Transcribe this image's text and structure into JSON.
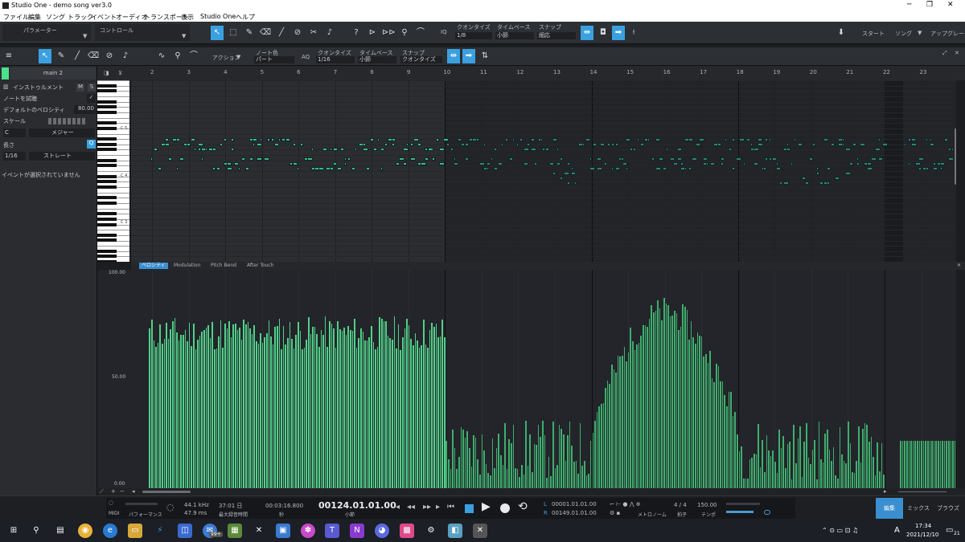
{
  "window": {
    "title": "Studio One - demo song ver3.0",
    "controls": [
      "─",
      "❐",
      "✕"
    ]
  },
  "menu": [
    "ファイル",
    "編集",
    "ソング",
    "トラック",
    "イベント",
    "オーディオ",
    "トランスポート",
    "表示",
    "Studio One",
    "ヘルプ"
  ],
  "toolbar": {
    "parameter_label": "パラメーター",
    "control_label": "コントロール",
    "iq": "IQ",
    "quantize_label": "クオンタイズ",
    "quantize_value": "1/8",
    "timebase_label": "タイムベース",
    "timebase_value": "小節",
    "snap_label": "スナップ",
    "snap_value": "細応",
    "start": "スタート",
    "song": "ソング",
    "upgrade": "アップグレード"
  },
  "editor": {
    "action": "アクション",
    "note_color_label": "ノート色",
    "note_color_value": "パート",
    "aq": "AQ",
    "quantize_label": "クオンタイズ",
    "quantize_value": "1/16",
    "timebase_label": "タイムベース",
    "timebase_value": "小節",
    "snap_label": "スナップ",
    "snap_value": "クオンタイズ"
  },
  "inspector": {
    "track": "main 2",
    "instrument": "インストゥルメント",
    "m": "M",
    "s": "S",
    "note_preview": "ノートを試聴",
    "default_velocity": "デフォルトのベロシティ",
    "default_velocity_value": "80.00",
    "scale": "スケール",
    "key": "C",
    "scale_type": "メジャー",
    "length": "長さ",
    "length_value": "1/16",
    "length_mode": "ストレート",
    "no_event": "イベントが選択されていません"
  },
  "keys": [
    "C 5",
    "C 4",
    "C 3"
  ],
  "ruler": [
    "2",
    "3",
    "4",
    "5",
    "6",
    "7",
    "8",
    "9",
    "10",
    "11",
    "12",
    "13",
    "14",
    "15",
    "16",
    "17",
    "18",
    "19",
    "20",
    "21",
    "22",
    "23"
  ],
  "lanes": [
    "ベロシティ",
    "Modulation",
    "Pitch Bend",
    "After Touch"
  ],
  "vel_axis": [
    "100.00",
    "50.00",
    "0.00"
  ],
  "transport": {
    "midi": "MIDI",
    "performance": "パフォーマンス",
    "sample_rate": "44.1 kHz",
    "latency": "47.9 ms",
    "rec_time": "37:01 日",
    "rec_time_label": "最大録音時間",
    "seconds": "00:03:16.800",
    "seconds_label": "秒",
    "bars": "00124.01.01.00",
    "bars_label": "小節",
    "loop_l_tag": "L",
    "loop_r_tag": "R",
    "loop_l": "00001.01.01.00",
    "loop_r": "00149.01.01.00",
    "metronome": "メトロノーム",
    "signature": "4 / 4",
    "signature_label": "拍子",
    "tempo": "150.00",
    "tempo_label": "テンポ"
  },
  "screens": [
    "編集",
    "ミックス",
    "ブラウズ"
  ],
  "taskbar": {
    "time": "17:34",
    "date": "2021/12/10",
    "badge": "99+",
    "notif": "21",
    "ime": "A"
  },
  "chart_data": {
    "type": "bar",
    "ylim": [
      0,
      100
    ],
    "velocity_profile": [
      {
        "from_bar": 1.9,
        "to_bar": 10,
        "level": 72,
        "spread": 8
      },
      {
        "from_bar": 10,
        "to_bar": 14,
        "level": 18,
        "spread": 14
      },
      {
        "from_bar": 14,
        "to_bar": 18,
        "level": 62,
        "spread": 22
      },
      {
        "from_bar": 18,
        "to_bar": 22,
        "level": 18,
        "spread": 14
      },
      {
        "from_bar": 22.4,
        "to_bar": 24.5,
        "level": 22,
        "spread": 0
      }
    ]
  },
  "colors": {
    "accent": "#3aa0e0",
    "note": "#3bbf72",
    "velocity": "#52d08a",
    "dim_note": "#2e8a58"
  }
}
